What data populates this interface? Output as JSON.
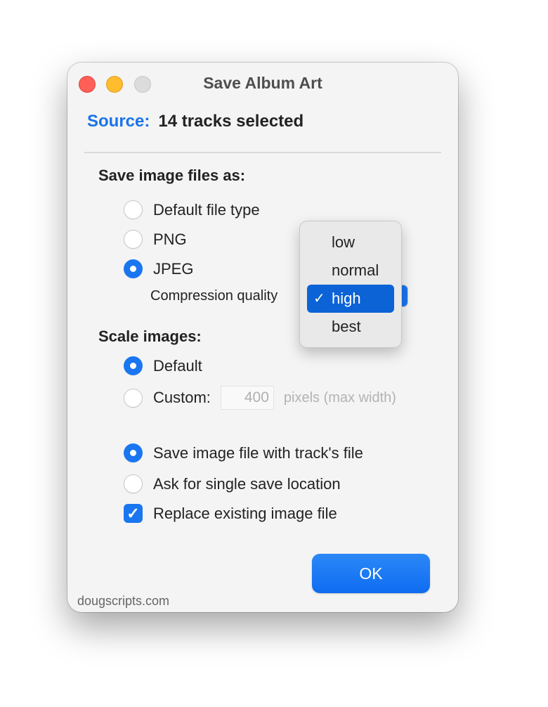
{
  "window": {
    "title": "Save Album Art",
    "controls": [
      "close",
      "minimize",
      "zoom"
    ]
  },
  "source": {
    "label": "Source:",
    "value": "14 tracks selected"
  },
  "file_type": {
    "heading": "Save image files as:",
    "options": [
      {
        "label": "Default file type",
        "selected": false
      },
      {
        "label": "PNG",
        "selected": false
      },
      {
        "label": "JPEG",
        "selected": true
      }
    ],
    "compression_label": "Compression quality",
    "compression_menu": {
      "items": [
        "low",
        "normal",
        "high",
        "best"
      ],
      "selected": "high",
      "check_glyph": "✓"
    }
  },
  "scale": {
    "heading": "Scale images:",
    "options": [
      {
        "label": "Default",
        "selected": true
      },
      {
        "label": "Custom:",
        "selected": false
      }
    ],
    "custom_value": "400",
    "custom_suffix": "pixels (max width)"
  },
  "location": {
    "options": [
      {
        "label": "Save image file with track's file",
        "selected": true
      },
      {
        "label": "Ask for single save location",
        "selected": false
      }
    ],
    "replace": {
      "label": "Replace existing image file",
      "checked": true,
      "glyph": "✓"
    }
  },
  "ok_button": "OK",
  "footer": "dougscripts.com",
  "colors": {
    "accent": "#1a76f0",
    "source_label": "#1a73e8",
    "menu_selection": "#0b63d6"
  }
}
